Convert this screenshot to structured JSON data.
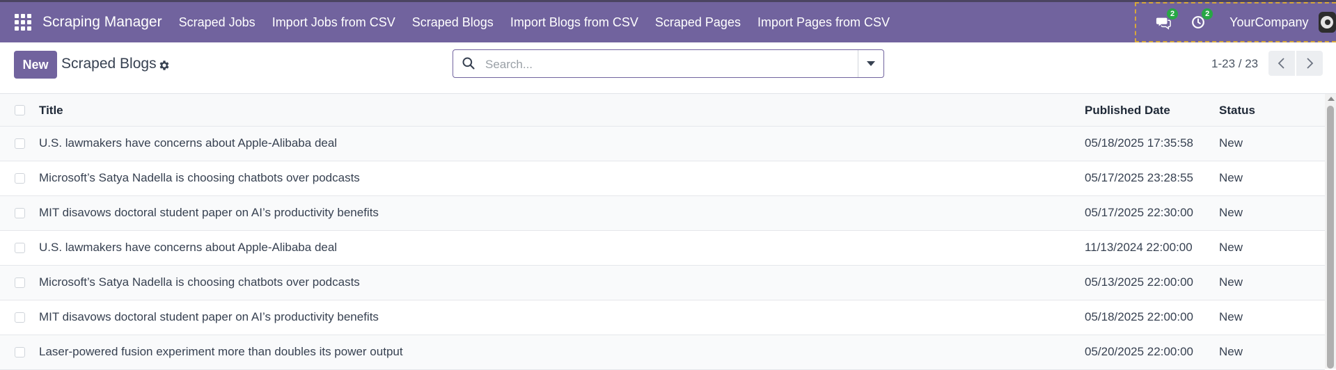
{
  "app": {
    "name": "Scraping Manager",
    "menu": [
      "Scraped Jobs",
      "Import Jobs from CSV",
      "Scraped Blogs",
      "Import Blogs from CSV",
      "Scraped Pages",
      "Import Pages from CSV"
    ]
  },
  "systray": {
    "messages_count": "2",
    "activities_count": "2",
    "company": "YourCompany"
  },
  "controls": {
    "new_label": "New",
    "page_title": "Scraped Blogs",
    "search_placeholder": "Search...",
    "pager": "1-23 / 23"
  },
  "table": {
    "columns": [
      "Title",
      "Published Date",
      "Status"
    ],
    "rows": [
      {
        "title": "U.S. lawmakers have concerns about Apple-Alibaba deal",
        "date": "05/18/2025 17:35:58",
        "status": "New"
      },
      {
        "title": "Microsoft’s Satya Nadella is choosing chatbots over podcasts",
        "date": "05/17/2025 23:28:55",
        "status": "New"
      },
      {
        "title": "MIT disavows doctoral student paper on AI’s productivity benefits",
        "date": "05/17/2025 22:30:00",
        "status": "New"
      },
      {
        "title": "U.S. lawmakers have concerns about Apple-Alibaba deal",
        "date": "11/13/2024 22:00:00",
        "status": "New"
      },
      {
        "title": "Microsoft’s Satya Nadella is choosing chatbots over podcasts",
        "date": "05/13/2025 22:00:00",
        "status": "New"
      },
      {
        "title": "MIT disavows doctoral student paper on AI’s productivity benefits",
        "date": "05/18/2025 22:00:00",
        "status": "New"
      },
      {
        "title": "Laser-powered fusion experiment more than doubles its power output",
        "date": "05/20/2025 22:00:00",
        "status": "New"
      }
    ]
  },
  "colors": {
    "brand": "#71639e",
    "badge": "#28a745"
  }
}
